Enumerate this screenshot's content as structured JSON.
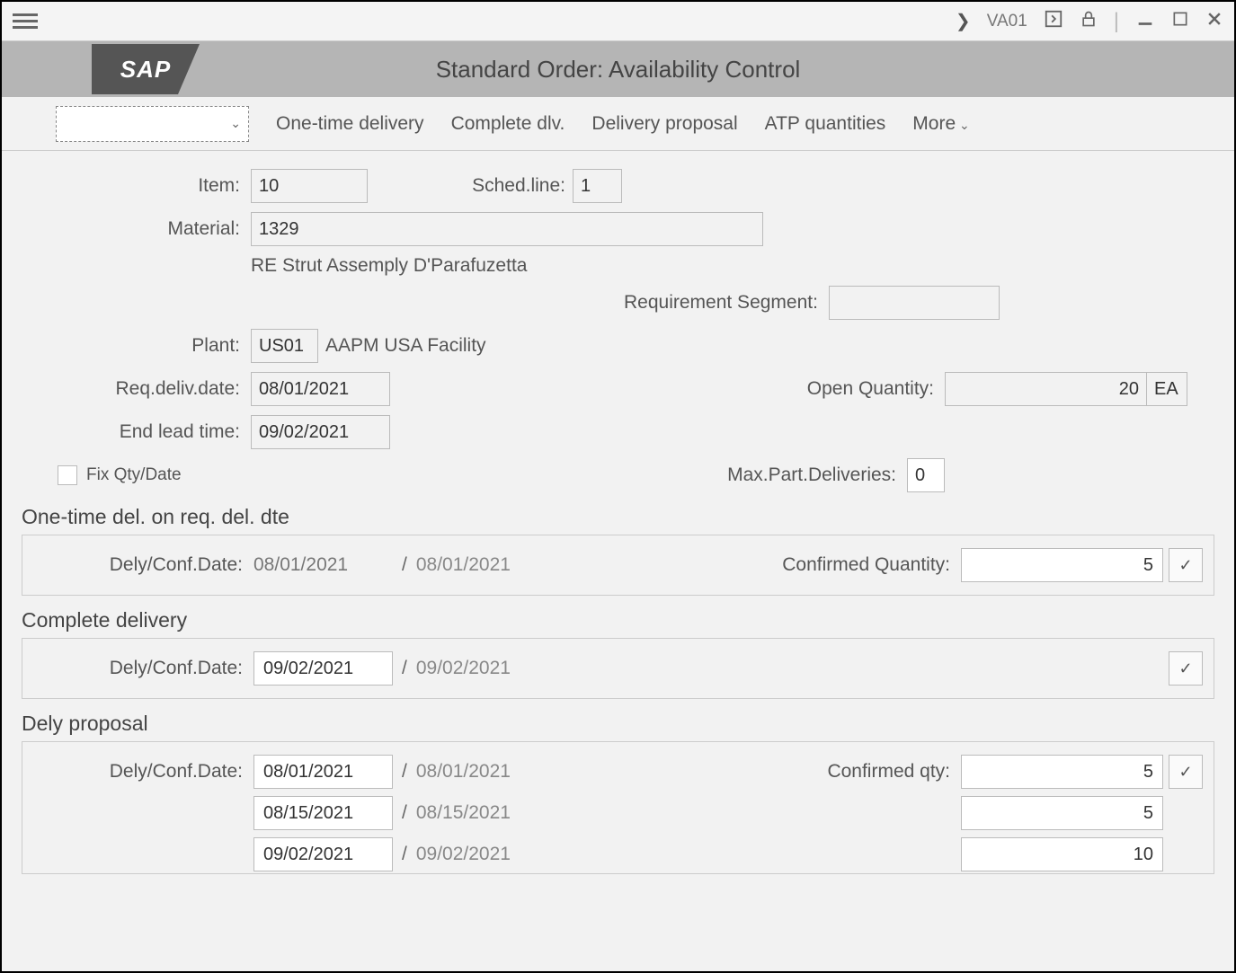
{
  "topbar": {
    "tcode": "VA01"
  },
  "title": "Standard Order: Availability Control",
  "toolbar": {
    "dropdown_value": "",
    "one_time_delivery": "One-time delivery",
    "complete_dlv": "Complete dlv.",
    "delivery_proposal": "Delivery proposal",
    "atp_quantities": "ATP quantities",
    "more": "More"
  },
  "fields": {
    "item_label": "Item:",
    "item_value": "10",
    "sched_line_label": "Sched.line:",
    "sched_line_value": "1",
    "material_label": "Material:",
    "material_value": "1329",
    "material_desc": "RE Strut Assemply D'Parafuzetta",
    "req_segment_label": "Requirement Segment:",
    "req_segment_value": "",
    "plant_label": "Plant:",
    "plant_value": "US01",
    "plant_desc": "AAPM USA Facility",
    "req_deliv_date_label": "Req.deliv.date:",
    "req_deliv_date_value": "08/01/2021",
    "open_qty_label": "Open Quantity:",
    "open_qty_value": "20",
    "open_qty_uom": "EA",
    "end_lead_time_label": "End lead time:",
    "end_lead_time_value": "09/02/2021",
    "fix_qty_date_label": "Fix Qty/Date",
    "max_part_deliv_label": "Max.Part.Deliveries:",
    "max_part_deliv_value": "0"
  },
  "sections": {
    "one_time": {
      "title": "One-time del. on req. del. dte",
      "dely_conf_label": "Dely/Conf.Date:",
      "date1": "08/01/2021",
      "date2": "08/01/2021",
      "confirmed_qty_label": "Confirmed Quantity:",
      "confirmed_qty_value": "5"
    },
    "complete": {
      "title": "Complete delivery",
      "dely_conf_label": "Dely/Conf.Date:",
      "date1": "09/02/2021",
      "date2": "09/02/2021"
    },
    "proposal": {
      "title": "Dely proposal",
      "dely_conf_label": "Dely/Conf.Date:",
      "confirmed_qty_label": "Confirmed qty:",
      "rows": [
        {
          "date1": "08/01/2021",
          "date2": "08/01/2021",
          "qty": "5"
        },
        {
          "date1": "08/15/2021",
          "date2": "08/15/2021",
          "qty": "5"
        },
        {
          "date1": "09/02/2021",
          "date2": "09/02/2021",
          "qty": "10"
        }
      ]
    }
  }
}
